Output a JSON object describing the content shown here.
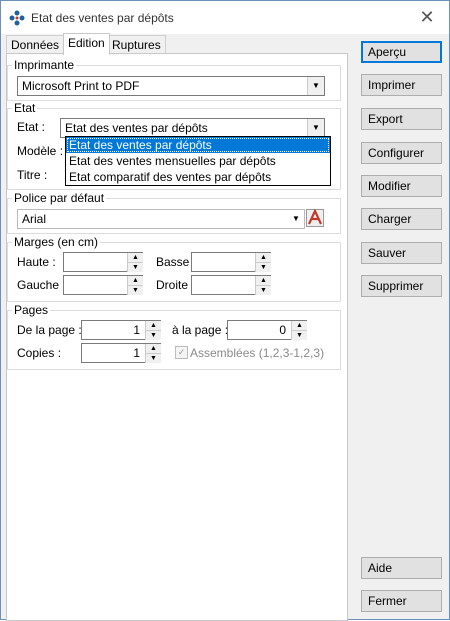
{
  "window": {
    "title": "Etat des ventes par dépôts"
  },
  "tabs": [
    {
      "label": "Données"
    },
    {
      "label": "Edition"
    },
    {
      "label": "Ruptures"
    }
  ],
  "printer": {
    "group": "Imprimante",
    "value": "Microsoft Print to PDF"
  },
  "etat": {
    "group": "Etat",
    "etat_label": "Etat :",
    "etat_value": "Etat des ventes par dépôts",
    "modele_label": "Modèle :",
    "titre_label": "Titre :",
    "options": [
      "Etat des ventes par dépôts",
      "Etat des ventes mensuelles par dépôts",
      "Etat comparatif des ventes par dépôts"
    ]
  },
  "font": {
    "group": "Police par défaut",
    "value": "Arial"
  },
  "margins": {
    "group": "Marges (en cm)",
    "haute": "Haute :",
    "basse": "Basse :",
    "gauche": "Gauche :",
    "droite": "Droite :"
  },
  "pages": {
    "group": "Pages",
    "from_label": "De la page :",
    "from_value": "1",
    "to_label": "à la page :",
    "to_value": "0",
    "copies_label": "Copies :",
    "copies_value": "1",
    "collate_label": "Assemblées (1,2,3-1,2,3)"
  },
  "buttons": {
    "apercu": "Aperçu",
    "imprimer": "Imprimer",
    "export": "Export",
    "configurer": "Configurer",
    "modifier": "Modifier",
    "charger": "Charger",
    "sauver": "Sauver",
    "supprimer": "Supprimer",
    "aide": "Aide",
    "fermer": "Fermer"
  }
}
